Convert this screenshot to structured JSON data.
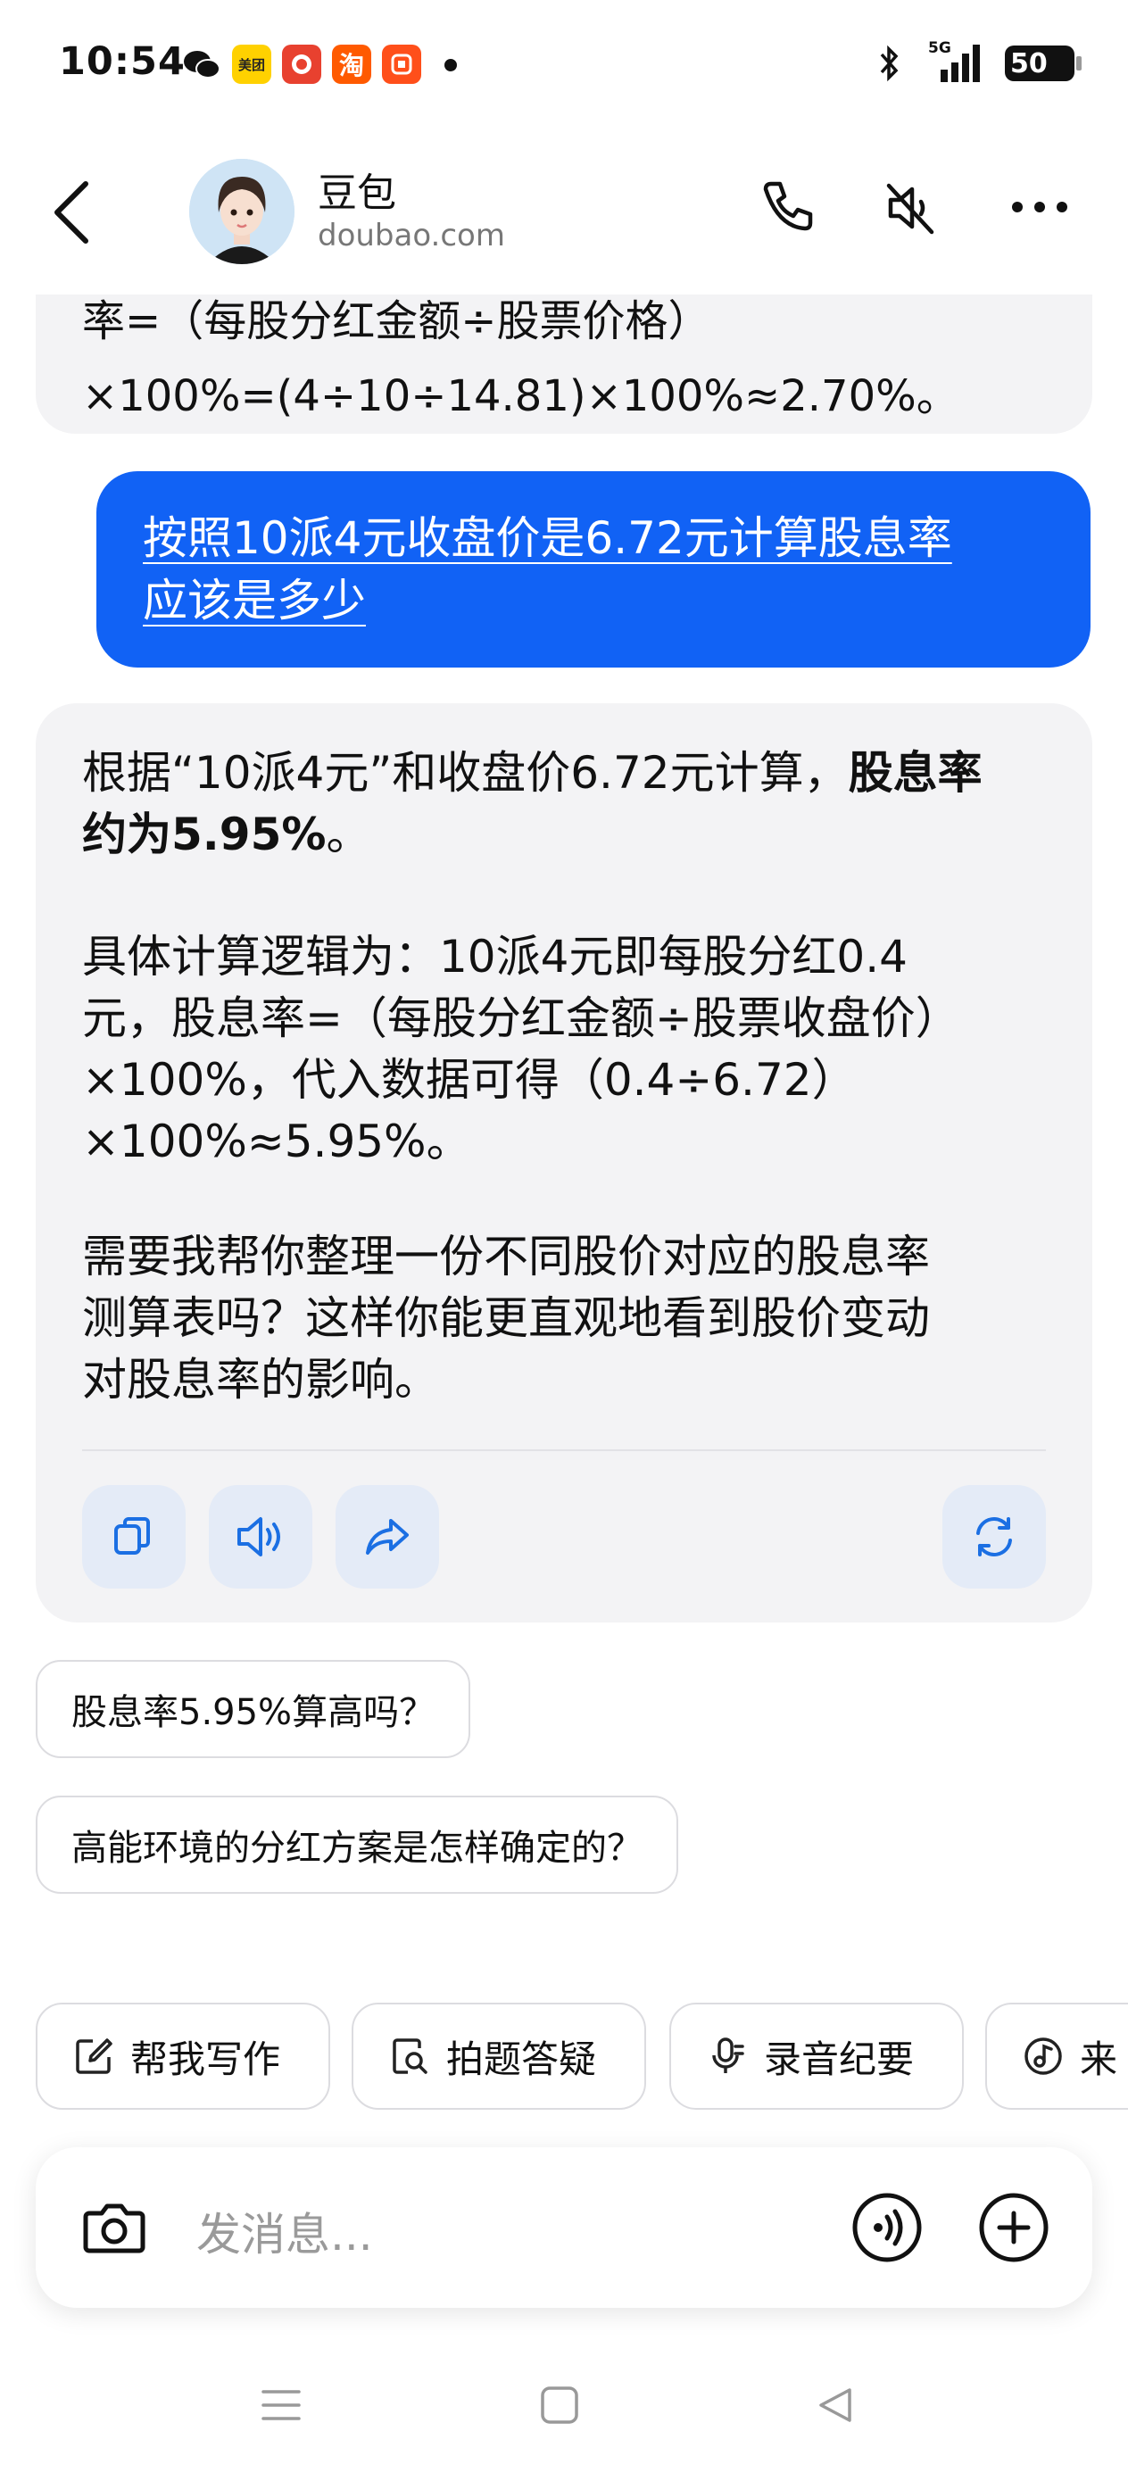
{
  "status_bar": {
    "time": "10:54",
    "notif_meituan": "美团",
    "notif_taobao": "淘",
    "network": "5G",
    "battery": "50"
  },
  "header": {
    "bot_name": "豆包",
    "bot_domain": "doubao.com"
  },
  "previous_message": {
    "clipped_text": "率=（每股分红金额÷股票价格）",
    "last_line": "×100%=(4÷10÷14.81)×100%≈2.70%。"
  },
  "user_message": {
    "line1": "按照10派4元收盘价是6.72元计算股息率",
    "line2": "应该是多少"
  },
  "ai_message": {
    "p1_line1_plain": "根据“10派4元”和收盘价6.72元计算，",
    "p1_line1_bold": "股息率",
    "p1_line2_bold": "约为5.95%",
    "p1_line2_plain": "。",
    "p2_line1": "具体计算逻辑为：10派4元即每股分红0.4",
    "p2_line2": "元，股息率=（每股分红金额÷股票收盘价）",
    "p2_line3": "×100%，代入数据可得（0.4÷6.72）",
    "p2_line4": "×100%≈5.95%。",
    "p3_line1": "需要我帮你整理一份不同股价对应的股息率",
    "p3_line2": "测算表吗？这样你能更直观地看到股价变动",
    "p3_line3": "对股息率的影响。"
  },
  "suggestions": [
    "股息率5.95%算高吗？",
    "高能环境的分红方案是怎样确定的？"
  ],
  "tools": [
    {
      "label": "帮我写作",
      "icon": "edit-icon"
    },
    {
      "label": "拍题答疑",
      "icon": "photo-search-icon"
    },
    {
      "label": "录音纪要",
      "icon": "microphone-icon"
    },
    {
      "label": "来",
      "icon": "music-icon"
    }
  ],
  "composer": {
    "placeholder": "发消息..."
  },
  "colors": {
    "accent": "#1162f5",
    "bubble_bg": "#f3f3f5",
    "action_bg": "#e4ebf7",
    "icon_blue": "#1b6fe3"
  }
}
